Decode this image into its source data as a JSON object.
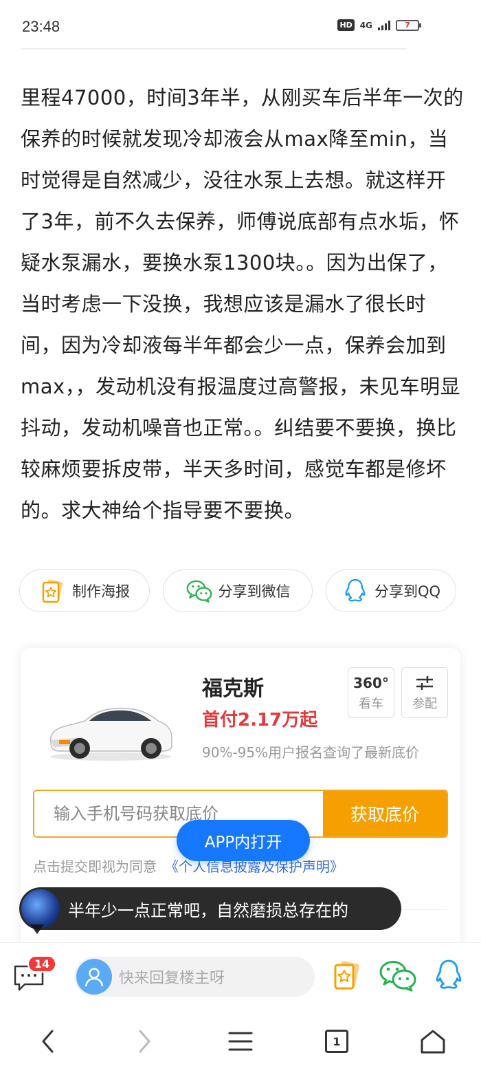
{
  "status_bar": {
    "time": "23:48",
    "hd": "HD",
    "network": "4G",
    "battery": "7"
  },
  "post": {
    "body": "里程47000，时间3年半，从刚买车后半年一次的保养的时候就发现冷却液会从max降至min，当时觉得是自然减少，没往水泵上去想。就这样开了3年，前不久去保养，师傅说底部有点水垢，怀疑水泵漏水，要换水泵1300块。。因为出保了，当时考虑一下没换，我想应该是漏水了很长时间，因为冷却液每半年都会少一点，保养会加到max，，发动机没有报温度过高警报，未见车明显抖动，发动机噪音也正常。。纠结要不要换，换比较麻烦要拆皮带，半天多时间，感觉车都是修坏的。求大神给个指导要不要换。"
  },
  "share": {
    "poster": "制作海报",
    "wechat": "分享到微信",
    "qq": "分享到QQ"
  },
  "car_card": {
    "name": "福克斯",
    "price": "首付2.17万起",
    "note": "90%-95%用户报名查询了最新底价",
    "btn_360_top": "360°",
    "btn_360_bottom": "看车",
    "btn_config_bottom": "参配",
    "phone_placeholder": "输入手机号码获取底价",
    "submit": "获取底价",
    "consent_prefix": "点击提交即视为同意",
    "consent_link": "《个人信息披露及保护声明》"
  },
  "app_open": "APP内打开",
  "danmaku": "半年少一点正常吧，自然磨损总存在的",
  "bottom_bar": {
    "badge": "14",
    "reply_placeholder": "快来回复楼主呀"
  },
  "navbar": {
    "tab_count": "1"
  },
  "colors": {
    "accent_orange": "#f5a000",
    "price_red": "#e4393c",
    "app_blue": "#1677ff",
    "wechat_green": "#22b14c",
    "qq_blue": "#1a9cf0"
  }
}
